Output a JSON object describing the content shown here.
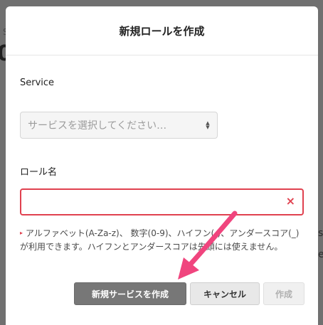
{
  "background": {
    "fragment_s": "S",
    "fragment_zero": "0",
    "fragment_right1": "s",
    "fragment_right2": "e"
  },
  "modal": {
    "title": "新規ロールを作成",
    "service_label": "Service",
    "service_select": {
      "placeholder": "サービスを選択してください…"
    },
    "role_name_label": "ロール名",
    "role_name_input": {
      "value": ""
    },
    "clear_icon": "×",
    "help_marker": "▸",
    "help_text": "アルファベット(A-Za-z)、 数字(0-9)、ハイフン(-)、アンダースコア(_)が利用できます。ハイフンとアンダースコアは先頭には使えません。",
    "buttons": {
      "create_service": "新規サービスを作成",
      "cancel": "キャンセル",
      "create": "作成"
    }
  },
  "colors": {
    "error": "#e0414f",
    "arrow": "#f0457e",
    "primary_button": "#777777"
  }
}
